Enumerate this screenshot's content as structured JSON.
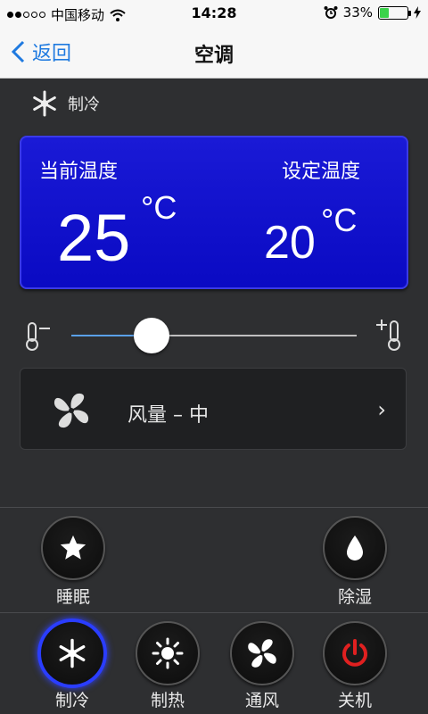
{
  "status_bar": {
    "carrier": "中国移动",
    "time": "14:28",
    "battery": "33%",
    "battery_level": 0.33
  },
  "nav": {
    "back_label": "返回",
    "title": "空调"
  },
  "mode": {
    "label": "制冷"
  },
  "temperature": {
    "current_label": "当前温度",
    "current_value": "25",
    "current_unit": "°C",
    "set_label": "设定温度",
    "set_value": "20",
    "set_unit": "°C"
  },
  "slider": {
    "level": 0.28
  },
  "fan": {
    "label": "风量 – 中",
    "chevron": "›"
  },
  "functions": {
    "sleep": "睡眠",
    "dehumidify": "除湿"
  },
  "modes": {
    "cool": "制冷",
    "heat": "制热",
    "fan": "通风",
    "power_off": "关机"
  },
  "colors": {
    "panel_blue": "#0a0ac3",
    "link_blue": "#1f7ae0",
    "active_ring": "#2a3dff",
    "power_red": "#e02020",
    "battery_green": "#3bd24a"
  }
}
